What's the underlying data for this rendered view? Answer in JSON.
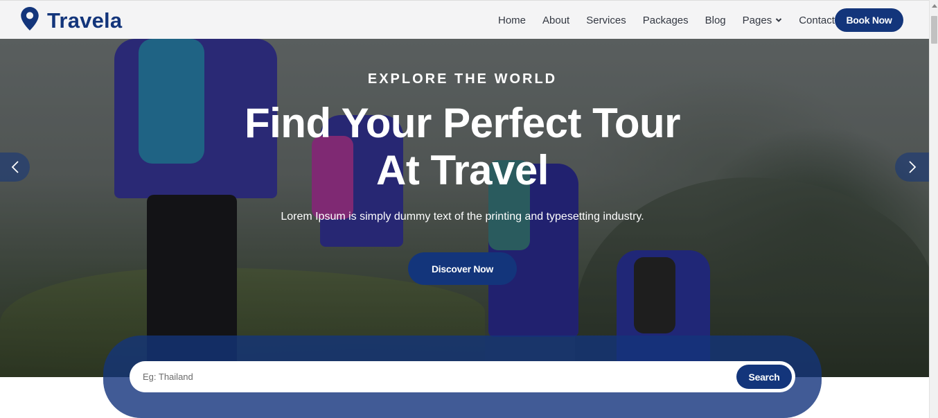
{
  "brand": {
    "name": "Travela",
    "icon": "map-pin-icon",
    "color": "#13357b"
  },
  "nav": {
    "items": [
      {
        "label": "Home"
      },
      {
        "label": "About"
      },
      {
        "label": "Services"
      },
      {
        "label": "Packages"
      },
      {
        "label": "Blog"
      },
      {
        "label": "Pages",
        "has_dropdown": true
      },
      {
        "label": "Contact"
      }
    ],
    "cta_label": "Book Now"
  },
  "hero": {
    "eyebrow": "EXPLORE THE WORLD",
    "headline": "Find Your Perfect Tour At Travel",
    "subtext": "Lorem Ipsum is simply dummy text of the printing and typesetting industry.",
    "cta_label": "Discover Now",
    "prev_icon": "chevron-left-icon",
    "next_icon": "chevron-right-icon"
  },
  "search": {
    "placeholder": "Eg: Thailand",
    "value": "",
    "button_label": "Search"
  },
  "colors": {
    "primary": "#13357b",
    "nav_bg": "#f4f4f5",
    "text": "#333842"
  }
}
